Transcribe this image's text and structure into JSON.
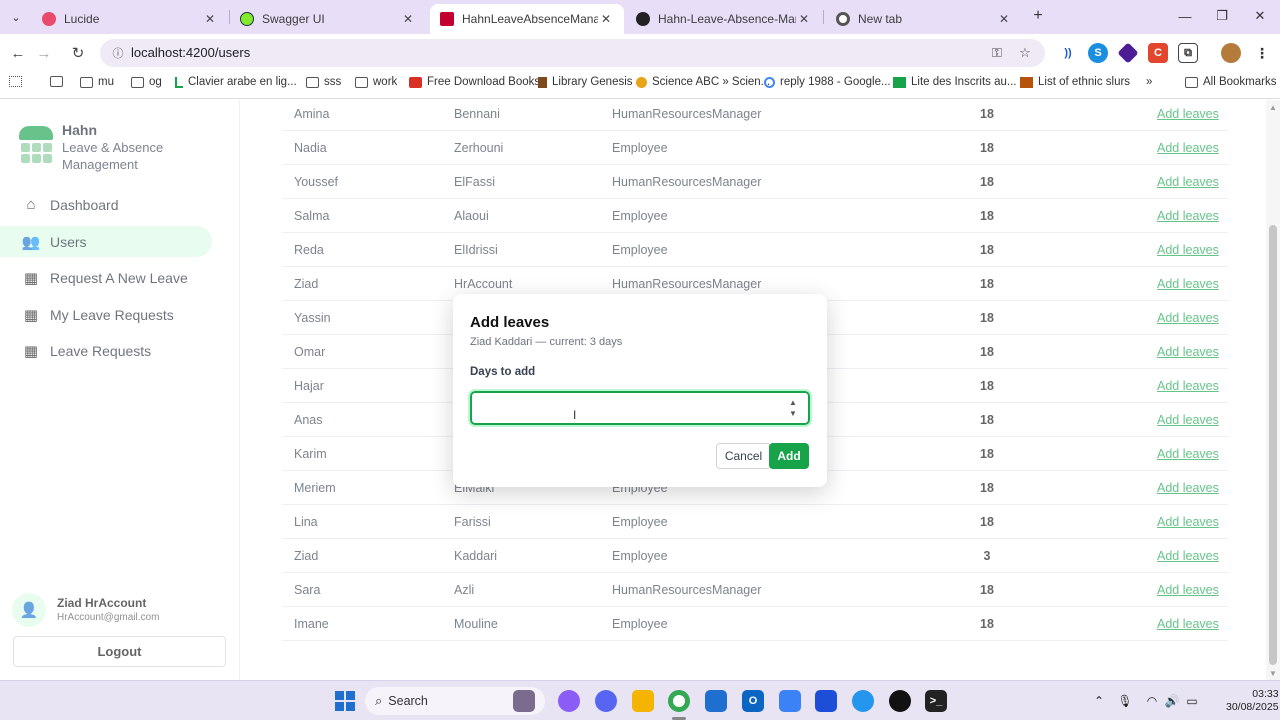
{
  "browser": {
    "tabs": [
      {
        "title": "Lucide",
        "active": false
      },
      {
        "title": "Swagger UI",
        "active": false
      },
      {
        "title": "HahnLeaveAbsenceManagem",
        "active": true
      },
      {
        "title": "Hahn-Leave-Absence-Manage",
        "active": false
      },
      {
        "title": "New tab",
        "active": false
      }
    ],
    "url": "localhost:4200/users",
    "bookmarks": [
      "mu",
      "og",
      "Clavier arabe en lig...",
      "sss",
      "work",
      "Free Download Books",
      "Library Genesis",
      "Science ABC » Scien...",
      "reply 1988 - Google...",
      "Lite des Inscrits au...",
      "List of ethnic slurs"
    ],
    "all_bookmarks": "All Bookmarks",
    "colors": {
      "tabbar": "#e8def8",
      "accent": "#16a34a"
    }
  },
  "sidebar": {
    "brand_name": "Hahn",
    "brand_line1": "Leave & Absence",
    "brand_line2": "Management",
    "items": [
      {
        "label": "Dashboard",
        "icon": "home-icon",
        "active": false
      },
      {
        "label": "Users",
        "icon": "users-icon",
        "active": true
      },
      {
        "label": "Request A New Leave",
        "icon": "calendar-plus-icon",
        "active": false
      },
      {
        "label": "My Leave Requests",
        "icon": "calendar-icon",
        "active": false
      },
      {
        "label": "Leave Requests",
        "icon": "calendar-clock-icon",
        "active": false
      }
    ],
    "user": {
      "name": "Ziad HrAccount",
      "email": "HrAccount@gmail.com"
    },
    "logout_label": "Logout"
  },
  "users_table": {
    "action_label": "Add leaves",
    "rows": [
      {
        "first": "Amina",
        "last": "Bennani",
        "role": "HumanResourcesManager",
        "balance": "18"
      },
      {
        "first": "Nadia",
        "last": "Zerhouni",
        "role": "Employee",
        "balance": "18"
      },
      {
        "first": "Youssef",
        "last": "ElFassi",
        "role": "HumanResourcesManager",
        "balance": "18"
      },
      {
        "first": "Salma",
        "last": "Alaoui",
        "role": "Employee",
        "balance": "18"
      },
      {
        "first": "Reda",
        "last": "ElIdrissi",
        "role": "Employee",
        "balance": "18"
      },
      {
        "first": "Ziad",
        "last": "HrAccount",
        "role": "HumanResourcesManager",
        "balance": "18"
      },
      {
        "first": "Yassin",
        "last": "",
        "role": "",
        "balance": "18"
      },
      {
        "first": "Omar",
        "last": "",
        "role": "",
        "balance": "18"
      },
      {
        "first": "Hajar",
        "last": "",
        "role": "",
        "balance": "18"
      },
      {
        "first": "Anas",
        "last": "",
        "role": "",
        "balance": "18"
      },
      {
        "first": "Karim",
        "last": "",
        "role": "",
        "balance": "18"
      },
      {
        "first": "Meriem",
        "last": "ElMalki",
        "role": "Employee",
        "balance": "18"
      },
      {
        "first": "Lina",
        "last": "Farissi",
        "role": "Employee",
        "balance": "18"
      },
      {
        "first": "Ziad",
        "last": "Kaddari",
        "role": "Employee",
        "balance": "3"
      },
      {
        "first": "Sara",
        "last": "Azli",
        "role": "HumanResourcesManager",
        "balance": "18"
      },
      {
        "first": "Imane",
        "last": "Mouline",
        "role": "Employee",
        "balance": "18"
      }
    ]
  },
  "modal": {
    "title": "Add leaves",
    "subtitle": "Ziad Kaddari — current: 3 days",
    "field_label": "Days to add",
    "field_value": "",
    "cancel_label": "Cancel",
    "add_label": "Add"
  },
  "taskbar": {
    "search_label": "Search",
    "time": "03:33",
    "date": "30/08/2025"
  }
}
